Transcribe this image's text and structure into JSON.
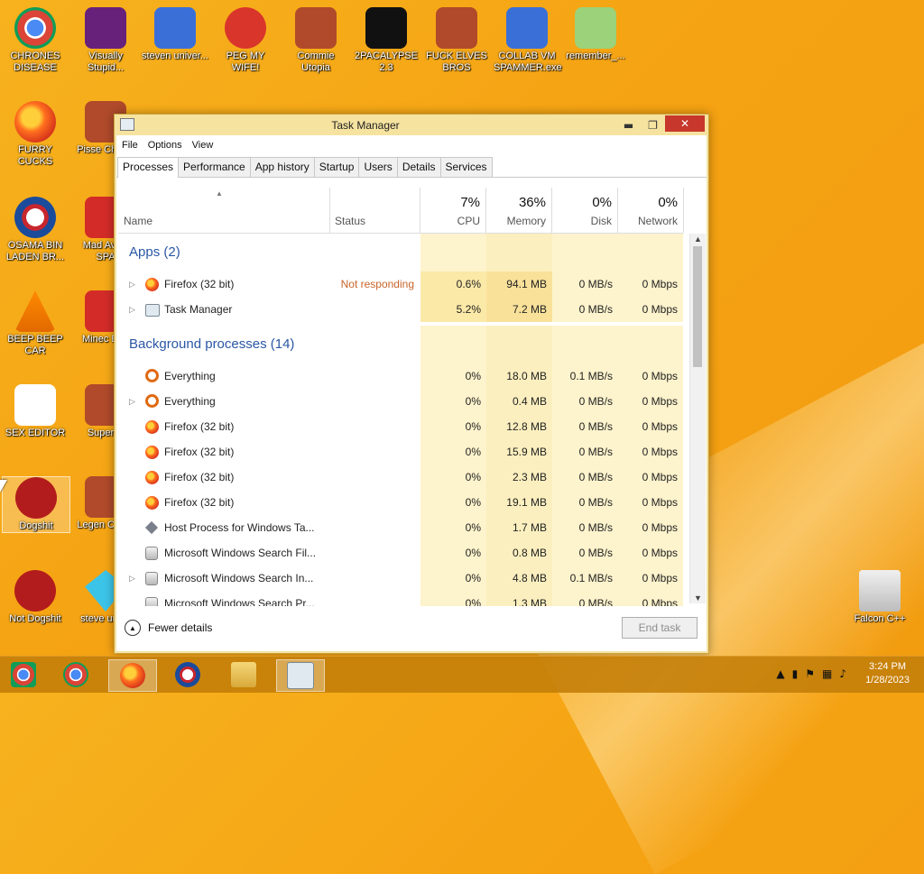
{
  "desktop": {
    "icons": [
      {
        "label": "CHRONES DISEASE",
        "icon": "chrome-icon"
      },
      {
        "label": "Visually Stupid...",
        "icon": "visual-studio-icon"
      },
      {
        "label": "steven univer...",
        "icon": "app-icon"
      },
      {
        "label": "PEG MY WIFE!",
        "icon": "peggle-icon"
      },
      {
        "label": "Commie Utopia",
        "icon": "game-icon"
      },
      {
        "label": "2PACALYPSE 2.3",
        "icon": "terminal-icon"
      },
      {
        "label": "FUCK ELVES BROS",
        "icon": "game-icon"
      },
      {
        "label": "COLLAB VM SPAMMER.exe",
        "icon": "app-icon"
      },
      {
        "label": "remember_...",
        "icon": "folder-zip-icon"
      },
      {
        "label": "FURRY CUCKS",
        "icon": "firefox-icon"
      },
      {
        "label": "Pisse Chicke",
        "icon": "game-icon"
      },
      {
        "label": "OSAMA BIN LADEN BR...",
        "icon": "obama-icon"
      },
      {
        "label": "Mad Av IN SPA",
        "icon": "angry-birds-icon"
      },
      {
        "label": "BEEP BEEP CAR",
        "icon": "vlc-icon"
      },
      {
        "label": "Minec Bird",
        "icon": "angry-birds-icon"
      },
      {
        "label": "SEX EDITOR",
        "icon": "hxd-icon"
      },
      {
        "label": "Super C",
        "icon": "game-icon"
      },
      {
        "label": "Dogshit",
        "icon": "devcpp-icon"
      },
      {
        "label": "Legen CRYA",
        "icon": "game-icon"
      },
      {
        "label": "Not Dogshit",
        "icon": "devcpp-icon"
      },
      {
        "label": "steve unive",
        "icon": "gem-icon"
      },
      {
        "label": "Falcon C++",
        "icon": "recycle-bin-icon"
      }
    ]
  },
  "window": {
    "title": "Task Manager",
    "minimize": "▬",
    "maximize": "❐",
    "close": "✕"
  },
  "menu": {
    "file": "File",
    "options": "Options",
    "view": "View"
  },
  "tabs": [
    "Processes",
    "Performance",
    "App history",
    "Startup",
    "Users",
    "Details",
    "Services"
  ],
  "columns": {
    "name": "Name",
    "status": "Status",
    "cpu": {
      "pct": "7%",
      "label": "CPU"
    },
    "memory": {
      "pct": "36%",
      "label": "Memory"
    },
    "disk": {
      "pct": "0%",
      "label": "Disk"
    },
    "network": {
      "pct": "0%",
      "label": "Network"
    }
  },
  "groups": {
    "apps": "Apps (2)",
    "background": "Background processes (14)"
  },
  "apps": [
    {
      "name": "Firefox (32 bit)",
      "status": "Not responding",
      "cpu": "0.6%",
      "mem": "94.1 MB",
      "disk": "0 MB/s",
      "net": "0 Mbps",
      "icon": "firefox-icon",
      "expand": true
    },
    {
      "name": "Task Manager",
      "status": "",
      "cpu": "5.2%",
      "mem": "7.2 MB",
      "disk": "0 MB/s",
      "net": "0 Mbps",
      "icon": "task-manager-icon",
      "expand": true
    }
  ],
  "background": [
    {
      "name": "Everything",
      "cpu": "0%",
      "mem": "18.0 MB",
      "disk": "0.1 MB/s",
      "net": "0 Mbps",
      "icon": "everything-icon",
      "expand": false
    },
    {
      "name": "Everything",
      "cpu": "0%",
      "mem": "0.4 MB",
      "disk": "0 MB/s",
      "net": "0 Mbps",
      "icon": "everything-icon",
      "expand": true
    },
    {
      "name": "Firefox (32 bit)",
      "cpu": "0%",
      "mem": "12.8 MB",
      "disk": "0 MB/s",
      "net": "0 Mbps",
      "icon": "firefox-icon",
      "expand": false
    },
    {
      "name": "Firefox (32 bit)",
      "cpu": "0%",
      "mem": "15.9 MB",
      "disk": "0 MB/s",
      "net": "0 Mbps",
      "icon": "firefox-icon",
      "expand": false
    },
    {
      "name": "Firefox (32 bit)",
      "cpu": "0%",
      "mem": "2.3 MB",
      "disk": "0 MB/s",
      "net": "0 Mbps",
      "icon": "firefox-icon",
      "expand": false
    },
    {
      "name": "Firefox (32 bit)",
      "cpu": "0%",
      "mem": "19.1 MB",
      "disk": "0 MB/s",
      "net": "0 Mbps",
      "icon": "firefox-icon",
      "expand": false
    },
    {
      "name": "Host Process for Windows Ta...",
      "cpu": "0%",
      "mem": "1.7 MB",
      "disk": "0 MB/s",
      "net": "0 Mbps",
      "icon": "host-process-icon",
      "expand": false
    },
    {
      "name": "Microsoft Windows Search Fil...",
      "cpu": "0%",
      "mem": "0.8 MB",
      "disk": "0 MB/s",
      "net": "0 Mbps",
      "icon": "search-service-icon",
      "expand": false
    },
    {
      "name": "Microsoft Windows Search In...",
      "cpu": "0%",
      "mem": "4.8 MB",
      "disk": "0.1 MB/s",
      "net": "0 Mbps",
      "icon": "search-service-icon",
      "expand": true
    },
    {
      "name": "Microsoft Windows Search Pr...",
      "cpu": "0%",
      "mem": "1.3 MB",
      "disk": "0 MB/s",
      "net": "0 Mbps",
      "icon": "search-service-icon",
      "expand": false
    }
  ],
  "footer": {
    "fewer_details": "Fewer details",
    "end_task": "End task"
  },
  "taskbar": {
    "items": [
      "chrome-alt-icon",
      "chrome-icon",
      "firefox-icon",
      "obama-icon",
      "file-explorer-icon",
      "task-manager-icon"
    ],
    "active_index": 2,
    "time": "3:24 PM",
    "date": "1/28/2023"
  }
}
